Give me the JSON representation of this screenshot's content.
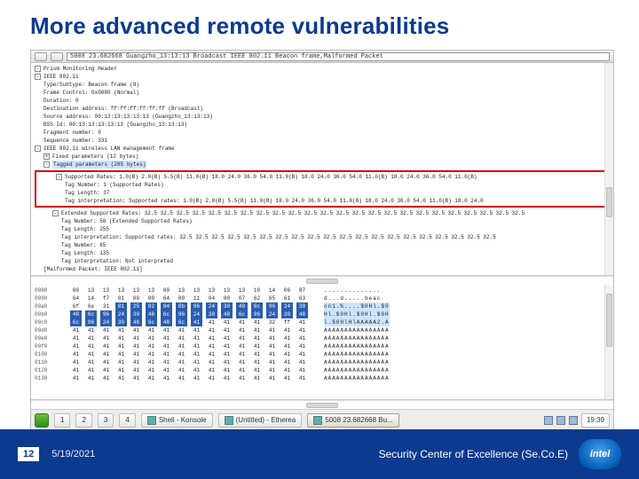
{
  "slide": {
    "title": "More advanced remote vulnerabilities"
  },
  "headerbar": {
    "summary": "5008 23.682668 Guangzho_13:13:13 Broadcast IEEE 802.11 Beacon frame,Malformed Packet"
  },
  "dissect": {
    "node0": "Prism Monitoring Header",
    "node1": "IEEE 802.11",
    "n1a": "Type/Subtype: Beacon frame (8)",
    "n1b": "Frame Control: 0x0080 (Normal)",
    "n1c": "Duration: 0",
    "n1d": "Destination address: ff:ff:ff:ff:ff:ff (Broadcast)",
    "n1e": "Source address: 00:13:13:13:13:13 (Guangzho_13:13:13)",
    "n1f": "BSS Id: 00:13:13:13:13:13 (Guangzho_13:13:13)",
    "n1g": "Fragment number: 0",
    "n1h": "Sequence number: 331",
    "node2": "IEEE 802.11 wireless LAN management frame",
    "node3": "Fixed parameters (12 bytes)",
    "node4": "Tagged parameters (285 bytes)",
    "red_l1": "Supported Rates: 1.0(B) 2.0(B) 5.5(B) 11.0(B) 18.0 24.0 36.0 54.0 11.0(B) 18.0 24.0 36.0 54.0 11.0(B) 18.0 24.0 36.0 54.0 11.0(B)",
    "red_l2": "Tag Number: 1 (Supported Rates)",
    "red_l3": "Tag Length: 37",
    "red_l4": "Tag interpretation: Supported rates: 1.0(B) 2.0(B) 5.5(B) 11.0(B) 18.0 24.0 36.0 54.0 11.0(B) 18.0 24.0 36.0 54.0 11.0(B) 18.0 24.0",
    "ext_h": "Extended Supported Rates: 32.5 32.5 32.5 32.5 32.5 32.5 32.5 32.5 32.5 32.5 32.5 32.5 32.5 32.5 32.5 32.5 32.5 32.5 32.5 32.5 32.5 32.5 32.5 32.5",
    "ext_a": "Tag Number: 50 (Extended Supported Rates)",
    "ext_b": "Tag Length: 255",
    "ext_c": "Tag interpretation: Supported rates: 32.5 32.5 32.5 32.5 32.5 32.5 32.5 32.5 32.5 32.5 32.5 32.5 32.5 32.5 32.5 32.5 32.5 32.5 32.5 32.5",
    "ext_d": "Tag Number: 65",
    "ext_e": "Tag Length: 135",
    "ext_f": "Tag interpretation: Not interpreted",
    "malformed": "[Malformed Packet: IEEE 802.11]"
  },
  "hex": {
    "rows": [
      {
        "addr": "0080",
        "bytes": [
          "00",
          "13",
          "13",
          "13",
          "13",
          "13",
          "00",
          "13",
          "13",
          "13",
          "13",
          "13",
          "10",
          "14",
          "06",
          "87"
        ],
        "ascii": ".............."
      },
      {
        "addr": "0090",
        "bytes": [
          "64",
          "14",
          "f7",
          "01",
          "00",
          "00",
          "64",
          "00",
          "11",
          "04",
          "00",
          "07",
          "62",
          "65",
          "61",
          "63"
        ],
        "ascii": "d...d.....beac"
      },
      {
        "addr": "00a0",
        "bytes": [
          "6f",
          "6e",
          "31",
          "01",
          "25",
          "82",
          "84",
          "8b",
          "96",
          "24",
          "30",
          "48",
          "6c",
          "96",
          "24",
          "30"
        ],
        "ascii": "on1.%....$0Hl.$0",
        "sel_start": 3,
        "sel_end": 15
      },
      {
        "addr": "00b0",
        "bytes": [
          "48",
          "6c",
          "96",
          "24",
          "30",
          "48",
          "6c",
          "96",
          "24",
          "30",
          "48",
          "6c",
          "96",
          "24",
          "30",
          "48"
        ],
        "ascii": "Hl.$0Hl.$0Hl.$0H",
        "sel_all": true
      },
      {
        "addr": "00c0",
        "bytes": [
          "6c",
          "96",
          "24",
          "30",
          "48",
          "6c",
          "48",
          "6c",
          "41",
          "41",
          "41",
          "41",
          "41",
          "32",
          "ff",
          "41"
        ],
        "ascii": "l.$0HlHlAAAAA2.A",
        "sel_start": 0,
        "sel_end": 8
      },
      {
        "addr": "00d0",
        "bytes": [
          "41",
          "41",
          "41",
          "41",
          "41",
          "41",
          "41",
          "41",
          "41",
          "41",
          "41",
          "41",
          "41",
          "41",
          "41",
          "41"
        ],
        "ascii": "AAAAAAAAAAAAAAAA"
      },
      {
        "addr": "00e0",
        "bytes": [
          "41",
          "41",
          "41",
          "41",
          "41",
          "41",
          "41",
          "41",
          "41",
          "41",
          "41",
          "41",
          "41",
          "41",
          "41",
          "41"
        ],
        "ascii": "AAAAAAAAAAAAAAAA"
      },
      {
        "addr": "00f0",
        "bytes": [
          "41",
          "41",
          "41",
          "41",
          "41",
          "41",
          "41",
          "41",
          "41",
          "41",
          "41",
          "41",
          "41",
          "41",
          "41",
          "41"
        ],
        "ascii": "AAAAAAAAAAAAAAAA"
      },
      {
        "addr": "0100",
        "bytes": [
          "41",
          "41",
          "41",
          "41",
          "41",
          "41",
          "41",
          "41",
          "41",
          "41",
          "41",
          "41",
          "41",
          "41",
          "41",
          "41"
        ],
        "ascii": "AAAAAAAAAAAAAAAA"
      },
      {
        "addr": "0110",
        "bytes": [
          "41",
          "41",
          "41",
          "41",
          "41",
          "41",
          "41",
          "41",
          "41",
          "41",
          "41",
          "41",
          "41",
          "41",
          "41",
          "41"
        ],
        "ascii": "AAAAAAAAAAAAAAAA"
      },
      {
        "addr": "0120",
        "bytes": [
          "41",
          "41",
          "41",
          "41",
          "41",
          "41",
          "41",
          "41",
          "41",
          "41",
          "41",
          "41",
          "41",
          "41",
          "41",
          "41"
        ],
        "ascii": "AAAAAAAAAAAAAAAA"
      },
      {
        "addr": "0130",
        "bytes": [
          "41",
          "41",
          "41",
          "41",
          "41",
          "41",
          "41",
          "41",
          "41",
          "41",
          "41",
          "41",
          "41",
          "41",
          "41",
          "41"
        ],
        "ascii": "AAAAAAAAAAAAAAAA"
      }
    ]
  },
  "taskbar": {
    "tabs": [
      "1",
      "2",
      "3",
      "4"
    ],
    "items": [
      {
        "label": "Shell - Konsole"
      },
      {
        "label": "(Untitled) - Etherea"
      },
      {
        "label": "5008 23.682668 Bu..."
      }
    ],
    "clock": "19:39"
  },
  "footer": {
    "page": "12",
    "date": "5/19/2021",
    "attribution": "Security Center of Excellence (Se.Co.E)",
    "logo_text": "intel"
  }
}
